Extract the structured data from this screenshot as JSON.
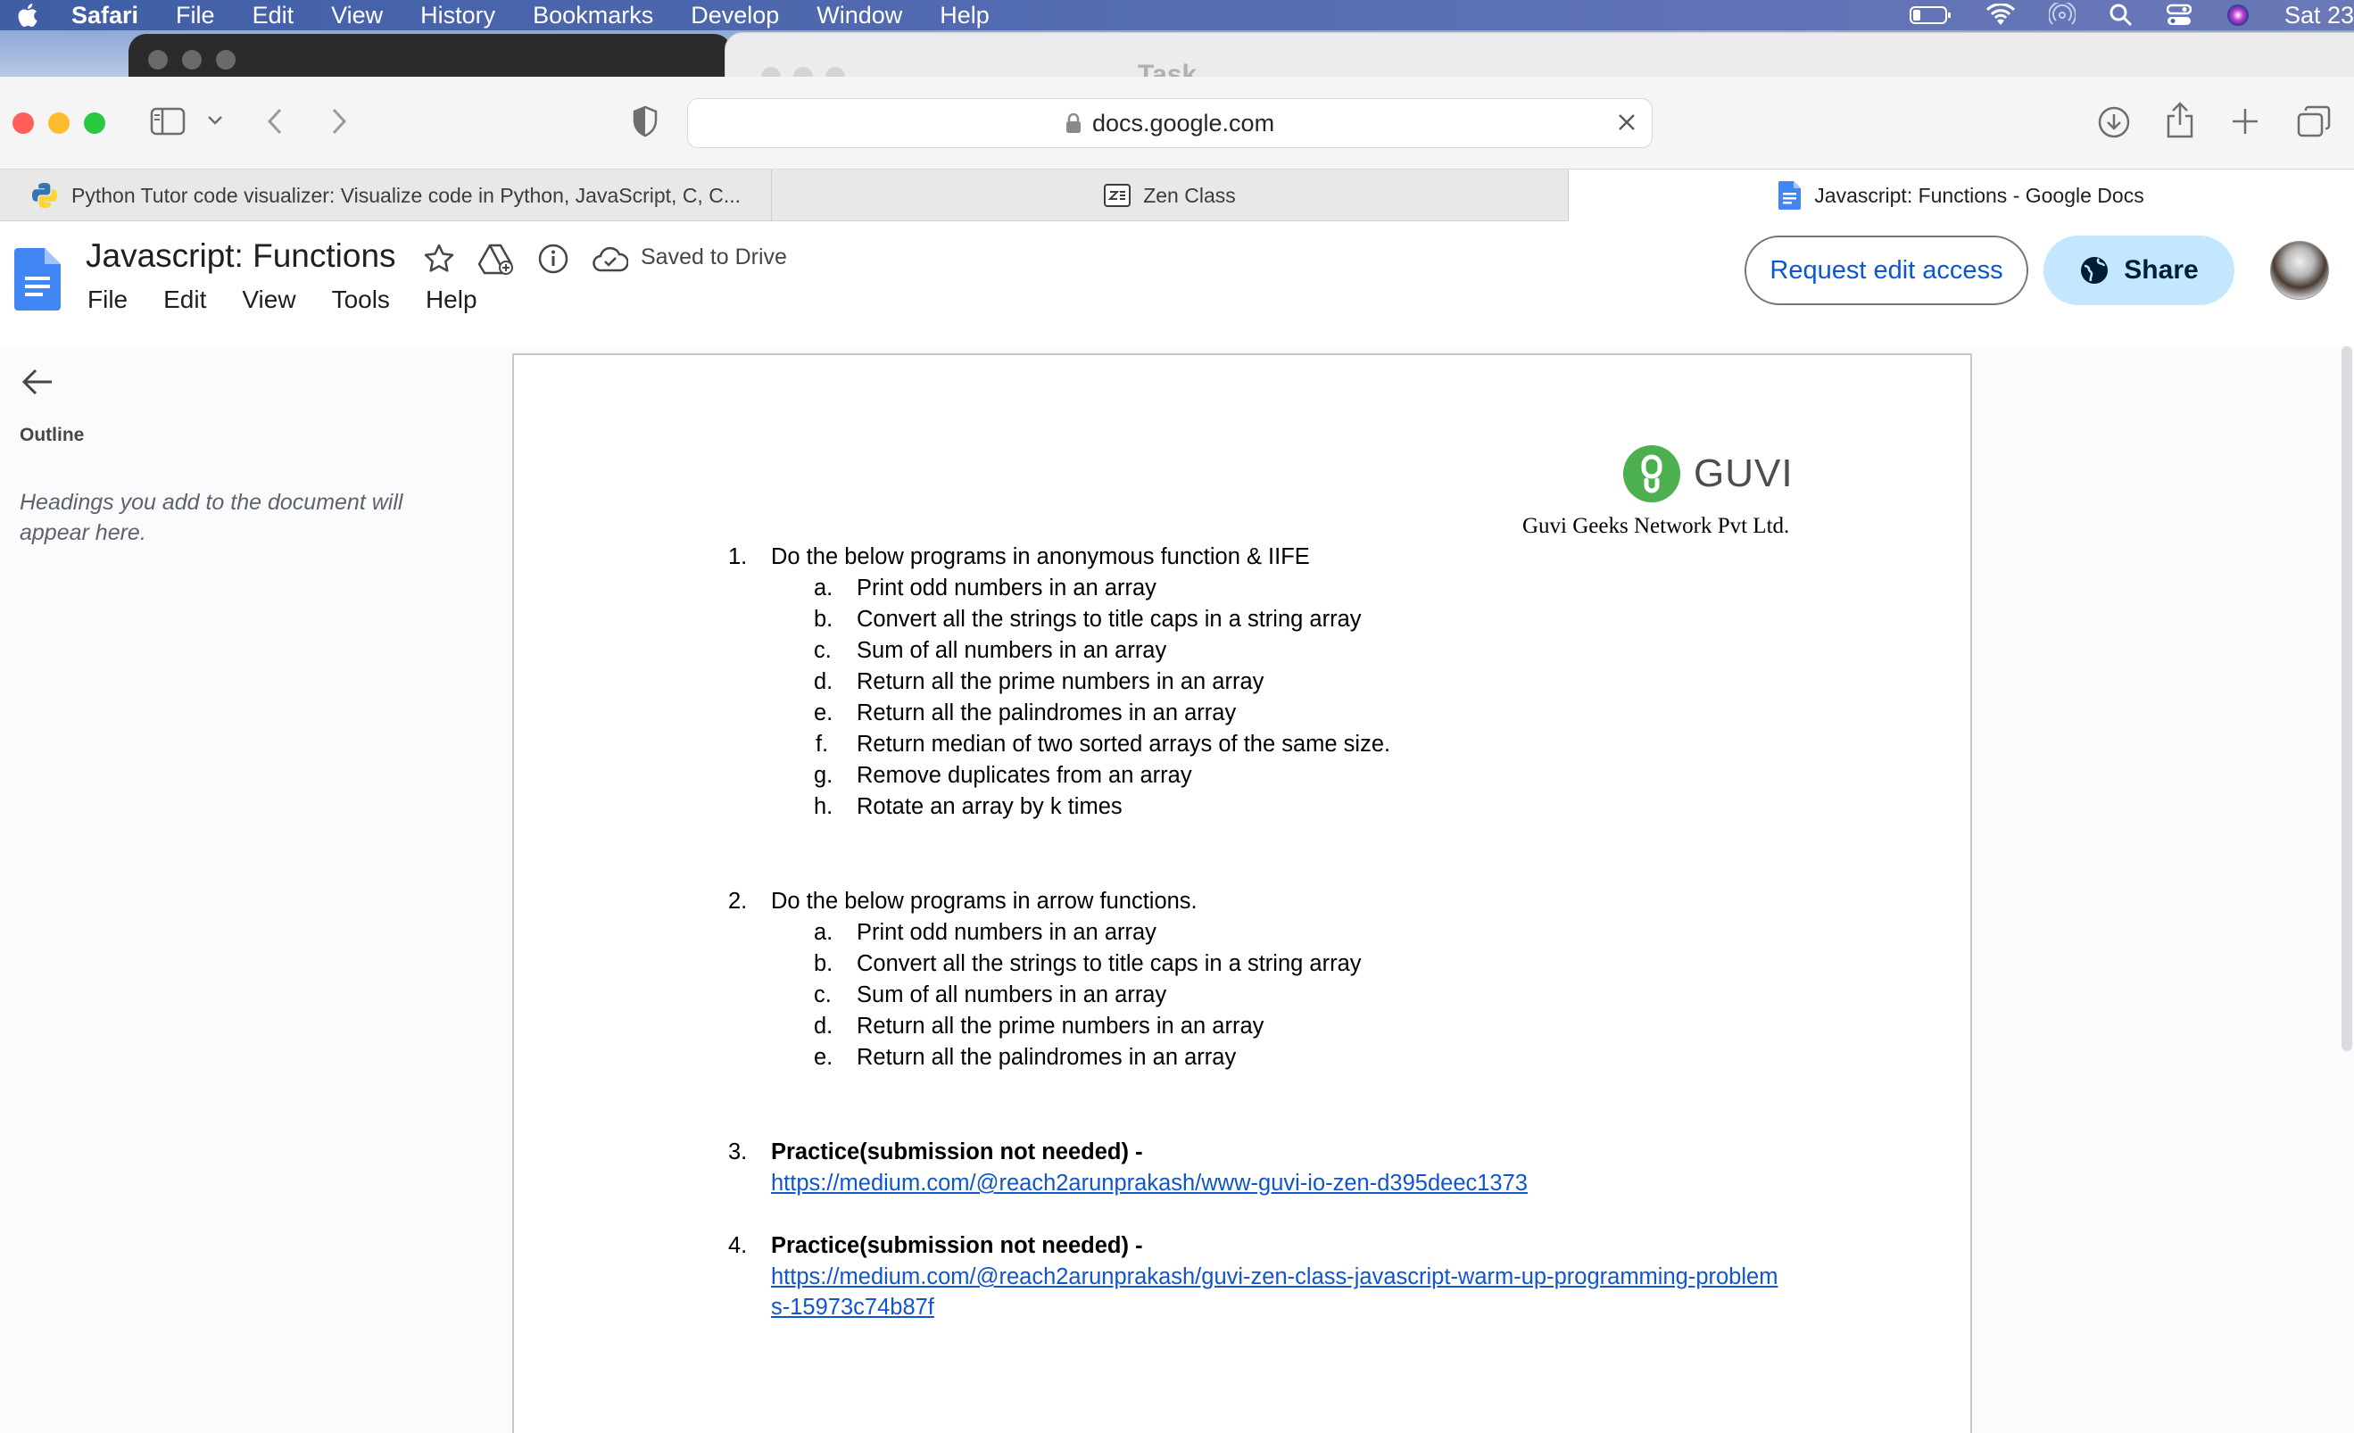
{
  "menubar": {
    "app": "Safari",
    "items": [
      "File",
      "Edit",
      "View",
      "History",
      "Bookmarks",
      "Develop",
      "Window",
      "Help"
    ],
    "clock": "Sat 23"
  },
  "ghost_window": {
    "title": "Task"
  },
  "toolbar": {
    "url": "docs.google.com"
  },
  "tabs": [
    {
      "label": "Python Tutor code visualizer: Visualize code in Python, JavaScript, C, C..."
    },
    {
      "label": "Zen Class"
    },
    {
      "label": "Javascript: Functions - Google Docs"
    }
  ],
  "doc": {
    "title": "Javascript: Functions",
    "saved_status": "Saved to Drive",
    "menu": [
      "File",
      "Edit",
      "View",
      "Tools",
      "Help"
    ],
    "request_edit_label": "Request edit access",
    "share_label": "Share"
  },
  "outline": {
    "title": "Outline",
    "hint": "Headings you add to the document will appear here."
  },
  "page": {
    "logo_word": "GUVI",
    "company": "Guvi Geeks Network Pvt Ltd.",
    "sections": [
      {
        "num": "1.",
        "text": "Do the below programs in anonymous function & IIFE",
        "items": [
          {
            "letter": "a.",
            "text": "Print odd numbers in an array"
          },
          {
            "letter": "b.",
            "text": "Convert all the strings to title caps in a string array"
          },
          {
            "letter": "c.",
            "text": "Sum of all numbers in an array"
          },
          {
            "letter": "d.",
            "text": "Return all the prime numbers in an array"
          },
          {
            "letter": "e.",
            "text": "Return all the palindromes in an array"
          },
          {
            "letter": "f.",
            "text": "Return median of two sorted arrays of the same size."
          },
          {
            "letter": "g.",
            "text": "Remove duplicates from an array"
          },
          {
            "letter": "h.",
            "text": "Rotate an array by k times"
          }
        ]
      },
      {
        "num": "2.",
        "text": "Do the below programs in arrow functions.",
        "items": [
          {
            "letter": "a.",
            "text": "Print odd numbers in an array"
          },
          {
            "letter": "b.",
            "text": "Convert all the strings to title caps in a string array"
          },
          {
            "letter": "c.",
            "text": "Sum of all numbers in an array"
          },
          {
            "letter": "d.",
            "text": "Return all the prime numbers in an array"
          },
          {
            "letter": "e.",
            "text": "Return all the palindromes in an array"
          }
        ]
      },
      {
        "num": "3.",
        "text": "Practice(submission not needed) -",
        "link": "https://medium.com/@reach2arunprakash/www-guvi-io-zen-d395deec1373"
      },
      {
        "num": "4.",
        "text": "Practice(submission not needed) -",
        "link_line1": "https://medium.com/@reach2arunprakash/guvi-zen-class-javascript-warm-up-programming-problem",
        "link_line2": "s-15973c74b87f"
      }
    ]
  },
  "colors": {
    "menubar": "#4a64ac",
    "share_bg": "#c2e7ff",
    "link": "#1155cc",
    "docs_blue": "#4285f4",
    "guvi_green": "#4caf50",
    "traffic_red": "#ff5f57",
    "traffic_yellow": "#febc2e",
    "traffic_green": "#28c840"
  }
}
